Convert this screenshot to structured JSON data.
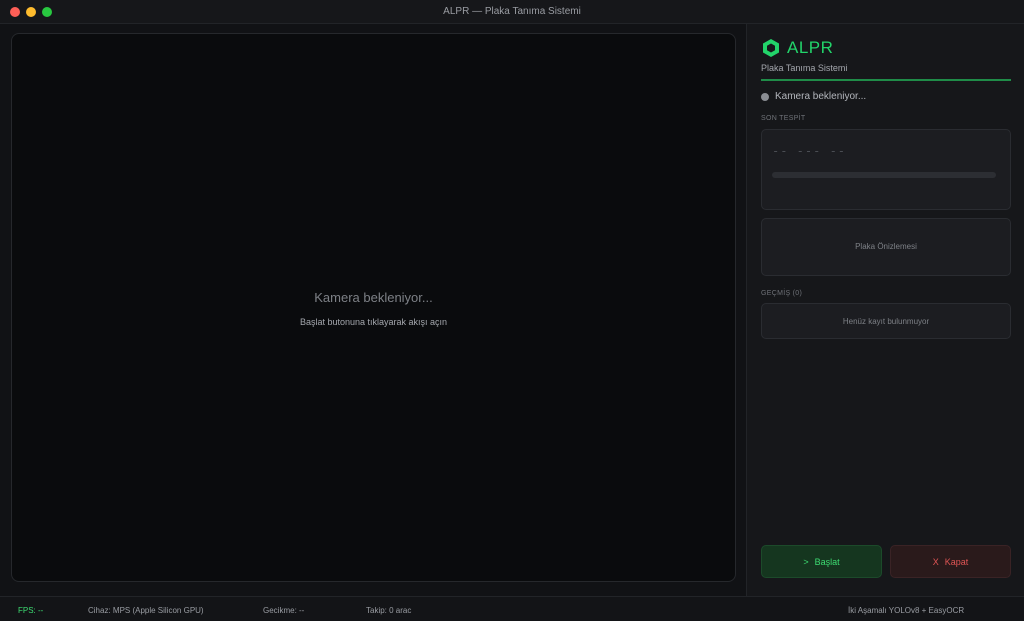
{
  "window": {
    "title": "ALPR — Plaka Tanıma Sistemi"
  },
  "video": {
    "message": "Kamera bekleniyor...",
    "hint": "Başlat butonuna tıklayarak akışı açın"
  },
  "sidebar": {
    "brand_name": "ALPR",
    "brand_subtitle": "Plaka Tanıma Sistemi",
    "status_text": "Kamera bekleniyor...",
    "last_detection_label": "SON TESPİT",
    "plate_placeholder": "-- --- --",
    "plate_preview_text": "Plaka Önizlemesi",
    "history_label": "GEÇMİŞ (0)",
    "history_empty": "Henüz kayıt bulunmuyor",
    "start_icon": ">",
    "start_label": "Başlat",
    "close_icon": "X",
    "close_label": "Kapat"
  },
  "statusbar": {
    "fps": "FPS: --",
    "device": "Cihaz: MPS (Apple Silicon GPU)",
    "latency": "Gecikme: --",
    "tracking": "Takip: 0 arac",
    "model": "İki Aşamalı YOLOv8 + EasyOCR"
  },
  "colors": {
    "accent": "#22d46a",
    "danger": "#e05555",
    "background": "#0d0e10"
  }
}
